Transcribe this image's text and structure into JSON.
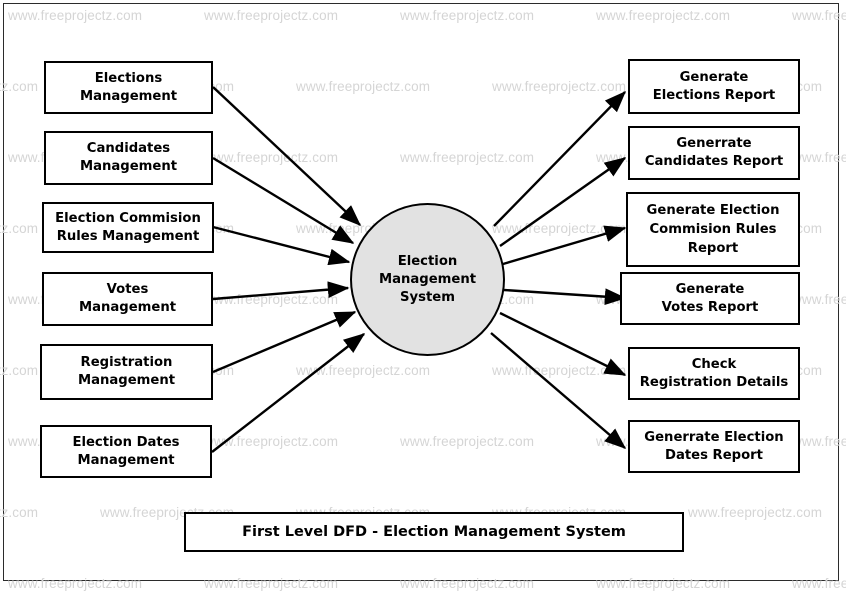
{
  "diagram": {
    "caption": "First Level DFD - Election Management System",
    "process": {
      "label": "Election\nManagement\nSystem",
      "fill": "#e2e2e2",
      "stroke": "#000000"
    },
    "watermark": {
      "text": "www.freeprojectz.com",
      "color": "#d5d5d5"
    },
    "inputs": [
      {
        "label": "Elections\nManagement"
      },
      {
        "label": "Candidates\nManagement"
      },
      {
        "label": "Election Commision\nRules Management"
      },
      {
        "label": "Votes\nManagement"
      },
      {
        "label": "Registration\nManagement"
      },
      {
        "label": "Election Dates\nManagement"
      }
    ],
    "outputs": [
      {
        "label": "Generate\nElections Report"
      },
      {
        "label": "Generrate\nCandidates Report"
      },
      {
        "label": "Generate Election\nCommision Rules\nReport"
      },
      {
        "label": "Generate\nVotes Report"
      },
      {
        "label": "Check\nRegistration Details"
      },
      {
        "label": "Generrate Election\nDates Report"
      }
    ]
  }
}
